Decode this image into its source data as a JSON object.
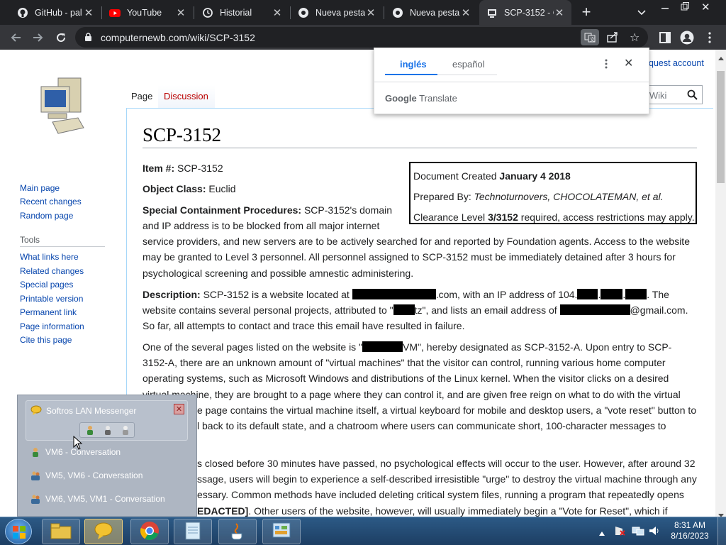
{
  "browser": {
    "tabs": [
      {
        "label": "GitHub - pal",
        "icon": "github-icon"
      },
      {
        "label": "YouTube",
        "icon": "youtube-icon"
      },
      {
        "label": "Historial",
        "icon": "history-icon"
      },
      {
        "label": "Nueva pestañ",
        "icon": "chrome-icon"
      },
      {
        "label": "Nueva pesta",
        "icon": "chrome-icon"
      },
      {
        "label": "SCP-3152 - C",
        "icon": "scp-icon"
      }
    ],
    "new_tab": "+",
    "url": "computernewb.com/wiki/SCP-3152"
  },
  "translate": {
    "lang_from": "inglés",
    "lang_to": "español",
    "brand": "Google",
    "brand_sub": "Translate"
  },
  "wiki": {
    "request_account": "quest account",
    "search_placeholder": "b Wiki",
    "nav": [
      "Main page",
      "Recent changes",
      "Random page"
    ],
    "tools_header": "Tools",
    "tools": [
      "What links here",
      "Related changes",
      "Special pages",
      "Printable version",
      "Permanent link",
      "Page information",
      "Cite this page"
    ],
    "tab_page": "Page",
    "tab_discussion": "Discussion",
    "title": "SCP-3152",
    "item_label": "Item #:",
    "item_value": "SCP-3152",
    "class_label": "Object Class:",
    "class_value": "Euclid",
    "doc_created_label": "Document Created",
    "doc_created_value": "January 4 2018",
    "prepared_label": "Prepared By:",
    "prepared_value": "Technoturnovers, CHOCOLATEMAN, et al.",
    "clearance_label": "Clearance Level",
    "clearance_value": "3/3152",
    "clearance_rest": "required, access restrictions may apply.",
    "scp_label": "Special Containment Procedures:",
    "scp_line1": "SCP-3152's domain",
    "scp_line2": "and IP address is to be blocked from all major internet",
    "scp_line3": "service providers, and new servers are to be actively searched for and reported by Foundation agents. Access to the website",
    "scp_line4": "may be granted to Level 3 personnel. All personnel assigned to SCP-3152 must be immediately detained after 3 hours for",
    "scp_line5": "psychological screening and possible amnestic administering.",
    "desc_label": "Description:",
    "desc_a": "SCP-3152 is a website located at",
    "desc_b": ".com, with an IP address of 104.",
    "desc_c": ". The",
    "desc_d": "website contains several personal projects, attributed to \"",
    "desc_e": "tz\", and lists an email address of",
    "desc_f": "@gmail.com.",
    "desc_g": "So far, all attempts to contact and trace this email have resulted in failure.",
    "p3_line1a": "One of the several pages listed on the website is \"",
    "p3_line1b": "VM\", hereby designated as SCP-3152-A. Upon entry to SCP-",
    "p3_line2": "3152-A, there are an unknown amount of \"virtual machines\" that the visitor can control, running various home computer",
    "p3_line3": "operating systems, such as Microsoft Windows and distributions of the Linux kernel. When the visitor clicks on a desired",
    "p3_line4": "virtual machine, they are brought to a page where they can control it, and are given free reign on what to do with the virtual",
    "p3_line5": "e page contains the virtual machine itself, a virtual keyboard for mobile and desktop users, a \"vote reset\" button to",
    "p3_line6": "l back to its default state, and a chatroom where users can communicate short, 100-character messages to",
    "p4_line1": "s closed before 30 minutes have passed, no psychological effects will occur to the user. However, after around 32",
    "p4_line2": "ssage, users will begin to experience a self-described irresistible \"urge\" to destroy the virtual machine through any",
    "p4_line3": "essary. Common methods have included deleting critical system files, running a program that repeatedly opens",
    "p4_line4a": "EDACTED]",
    "p4_line4b": ". Other users of the website, however, will usually immediately begin a \"Vote for Reset\", which if"
  },
  "messenger": {
    "title": "Softros LAN Messenger",
    "items": [
      "VM6 - Conversation",
      "VM5, VM6 - Conversation",
      "VM6, VM5, VM1 - Conversation"
    ]
  },
  "taskbar": {
    "time": "8:31 AM",
    "date": "8/16/2023"
  }
}
